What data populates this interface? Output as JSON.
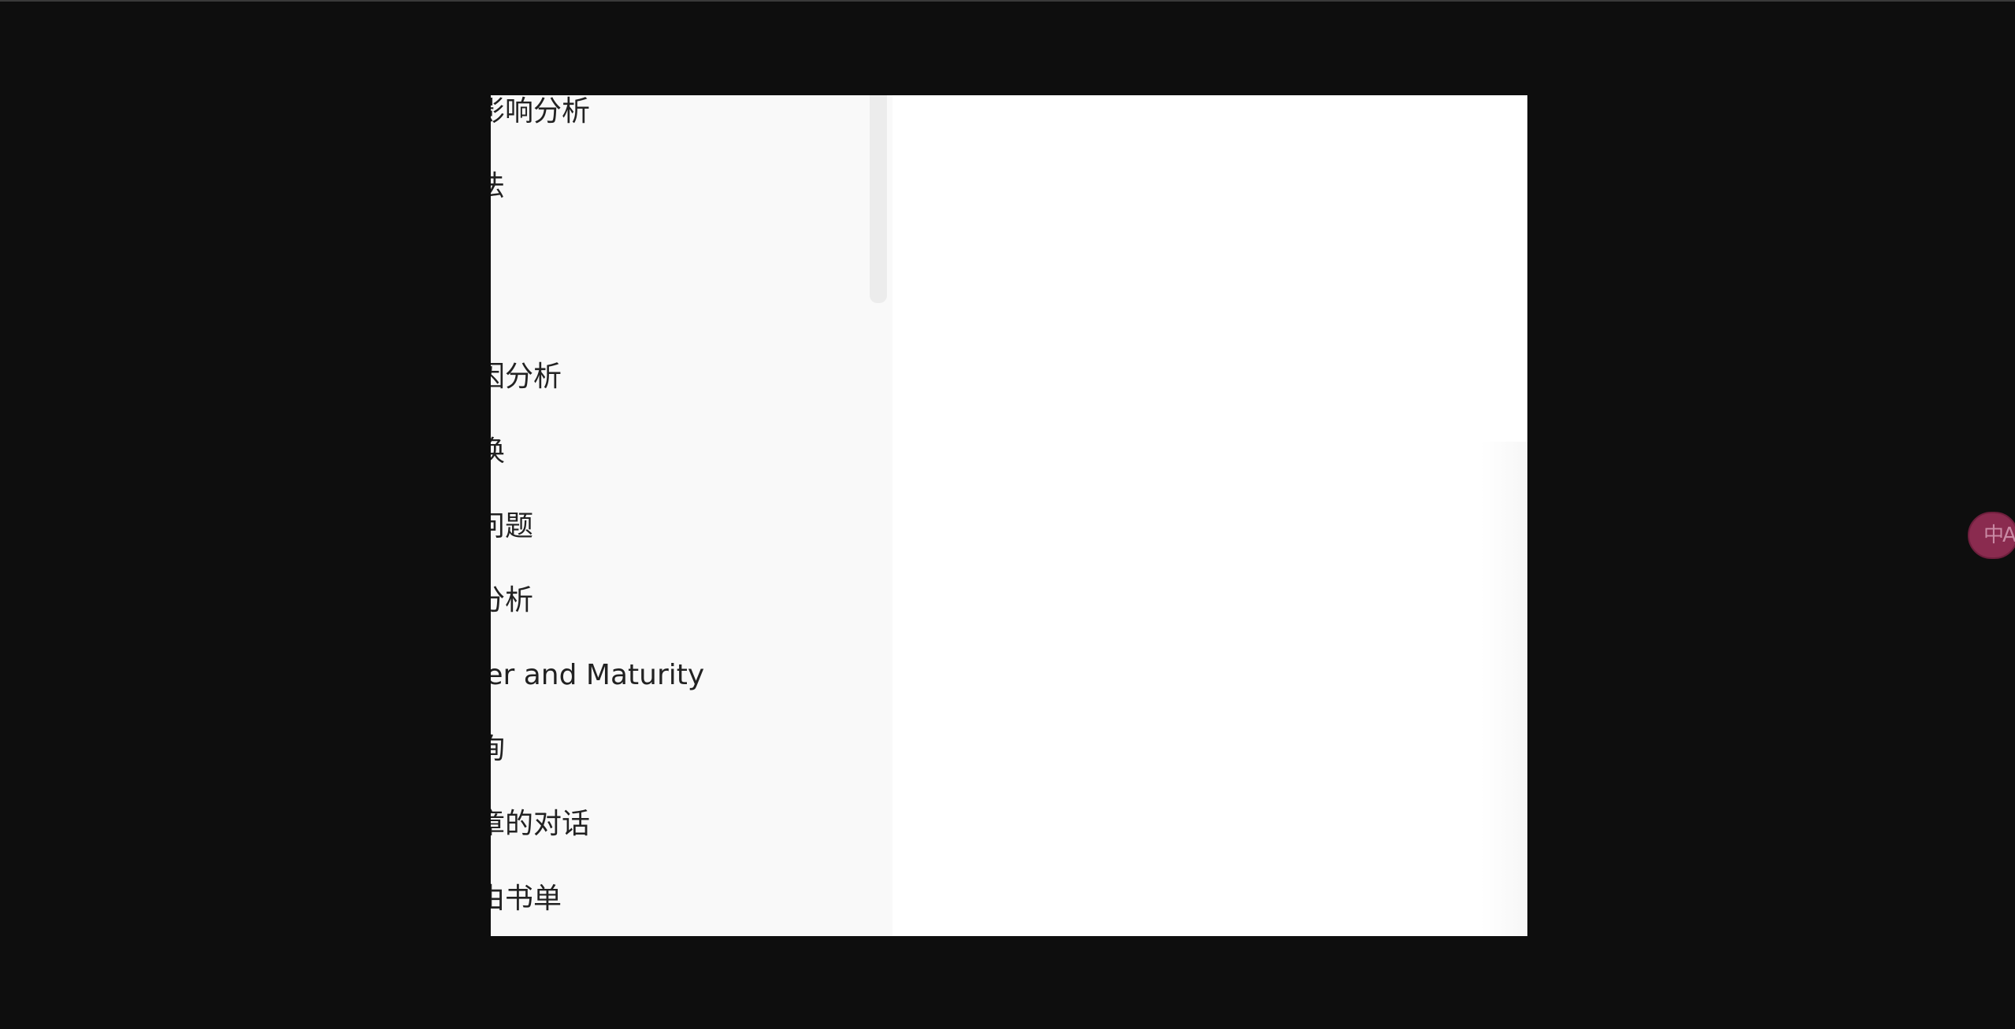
{
  "sidebar": {
    "conversations": [
      {
        "title": "温度影响分析"
      },
      {
        "title": "找算法"
      },
      {
        "title": ""
      },
      {
        "title": "线原因分析"
      },
      {
        "title": "径转换"
      },
      {
        "title": "责任问题"
      },
      {
        "title": "位置分析"
      },
      {
        "title": "Career and Maturity"
      },
      {
        "title": "题咨询"
      },
      {
        "title": "验那章的对话"
      },
      {
        "title": "富自由书单"
      }
    ]
  },
  "floating": {
    "translate_glyph": "中A",
    "translate_icon": "translate-icon"
  },
  "colors": {
    "backdrop": "#0e0e0e",
    "sidebar_bg": "#f9f9f9",
    "main_bg": "#ffffff",
    "text": "#222222",
    "translate_accent": "#8a2b4f"
  }
}
